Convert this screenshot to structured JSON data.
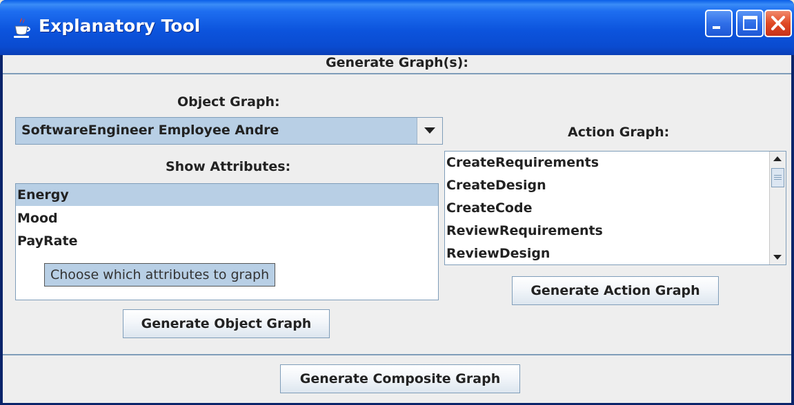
{
  "window": {
    "title": "Explanatory Tool",
    "controls": {
      "minimize": "minimize",
      "maximize": "maximize",
      "close": "close"
    }
  },
  "header": {
    "label": "Generate Graph(s):"
  },
  "object_panel": {
    "title": "Object Graph:",
    "selected_object": "SoftwareEngineer Employee Andre",
    "attributes_label": "Show Attributes:",
    "attributes": [
      {
        "label": "Energy",
        "selected": true
      },
      {
        "label": "Mood",
        "selected": false
      },
      {
        "label": "PayRate",
        "selected": false
      }
    ],
    "tooltip": "Choose which attributes to graph",
    "generate_button": "Generate Object Graph"
  },
  "action_panel": {
    "title": "Action Graph:",
    "actions": [
      "CreateRequirements",
      "CreateDesign",
      "CreateCode",
      "ReviewRequirements",
      "ReviewDesign"
    ],
    "generate_button": "Generate Action Graph"
  },
  "footer": {
    "composite_button": "Generate Composite Graph"
  },
  "icons": {
    "app": "java-cup-icon",
    "minimize": "minimize-icon",
    "maximize": "maximize-icon",
    "close": "close-icon",
    "dropdown": "chevron-down-icon",
    "scroll_up": "scroll-up-icon",
    "scroll_down": "scroll-down-icon"
  },
  "colors": {
    "titlebar": "#0c54dd",
    "selection": "#b8cfe5",
    "border": "#7f9db9",
    "close_button": "#e04a25"
  }
}
